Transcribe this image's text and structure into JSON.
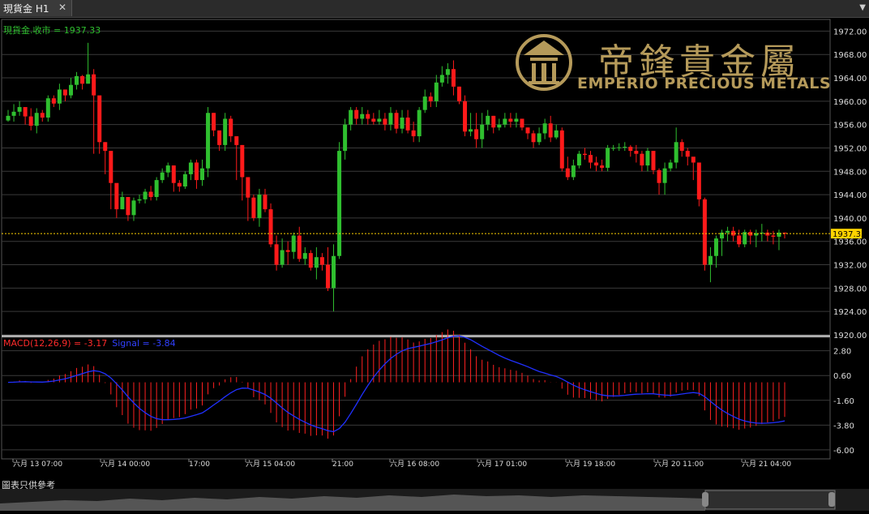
{
  "tab": {
    "title": "現貨金 H1",
    "close": "✕",
    "menu": "▼"
  },
  "price_legend": "現貨金.收市 = 1937.33",
  "macd_legend": {
    "macd": "MACD(12,26,9) = -3.17",
    "signal": "Signal = -3.84"
  },
  "footer_note": "圖表只供參考",
  "logo": {
    "en": "EMPERIO PRECIOUS METALS",
    "cn": "帝鋒貴金屬"
  },
  "colors": {
    "up": "#2fbf2f",
    "down": "#ff1a1a",
    "macd_hist": "#ff2020",
    "signal": "#2030ff",
    "current": "#ffd400",
    "grid": "#3a3a3a",
    "bg": "#000000"
  },
  "chart_data": [
    {
      "type": "candlestick",
      "title": "現貨金 H1",
      "current_price": 1937.33,
      "current_price_label": "1937.33",
      "ylim": [
        1920,
        1974
      ],
      "y_ticks": [
        "1972.00",
        "1968.00",
        "1964.00",
        "1960.00",
        "1956.00",
        "1952.00",
        "1948.00",
        "1944.00",
        "1940.00",
        "1936.00",
        "1932.00",
        "1928.00",
        "1924.00",
        "1920.00"
      ],
      "x_tick_labels": [
        "六月 13 07:00",
        "六月 14 00:00",
        "17:00",
        "六月 15 04:00",
        "21:00",
        "六月 16 08:00",
        "六月 17 01:00",
        "六月 19 18:00",
        "六月 20 11:00",
        "六月 21 04:00"
      ],
      "closes": [
        1957.5,
        1958.2,
        1959.0,
        1957.4,
        1955.8,
        1958.0,
        1957.2,
        1960.5,
        1959.6,
        1962.0,
        1961.0,
        1962.8,
        1964.3,
        1963.0,
        1964.6,
        1961.0,
        1953.0,
        1951.5,
        1946.0,
        1941.5,
        1943.6,
        1940.5,
        1943.0,
        1943.2,
        1944.5,
        1943.6,
        1946.5,
        1947.8,
        1949.0,
        1946.0,
        1945.4,
        1947.5,
        1949.5,
        1946.5,
        1948.5,
        1958.0,
        1955.0,
        1952.5,
        1957.0,
        1954.0,
        1952.5,
        1947.0,
        1943.5,
        1940.0,
        1944.0,
        1941.5,
        1935.5,
        1932.0,
        1934.5,
        1934.2,
        1937.0,
        1933.0,
        1934.0,
        1931.5,
        1933.3,
        1932.0,
        1928.0,
        1933.5,
        1951.5,
        1956.0,
        1958.5,
        1957.0,
        1957.8,
        1957.0,
        1956.5,
        1957.0,
        1956.0,
        1958.0,
        1955.3,
        1957.2,
        1955.0,
        1954.0,
        1958.5,
        1960.8,
        1960.0,
        1963.2,
        1964.5,
        1965.5,
        1962.5,
        1960.0,
        1954.8,
        1955.2,
        1953.5,
        1956.0,
        1957.5,
        1955.5,
        1956.0,
        1957.0,
        1956.5,
        1957.0,
        1955.5,
        1954.5,
        1953.0,
        1954.5,
        1956.2,
        1953.8,
        1955.0,
        1948.5,
        1947.0,
        1949.0,
        1951.0,
        1950.8,
        1949.5,
        1949.0,
        1948.6,
        1952.0,
        1952.0,
        1952.1,
        1952.2,
        1951.5,
        1951.0,
        1949.0,
        1951.5,
        1948.2,
        1946.0,
        1948.5,
        1949.5,
        1953.0,
        1951.5,
        1950.5,
        1949.5,
        1943.2,
        1932.0,
        1933.5,
        1936.5,
        1937.5,
        1937.8,
        1937.0,
        1935.5,
        1937.6,
        1937.0,
        1937.4,
        1937.5,
        1937.0,
        1936.8,
        1937.5,
        1937.33
      ],
      "highs": [
        1958.5,
        1959.5,
        1960.0,
        1958.5,
        1958.8,
        1958.8,
        1958.5,
        1961.0,
        1961.0,
        1963.0,
        1962.0,
        1964.0,
        1965.0,
        1964.5,
        1970.0,
        1965.5,
        1958.0,
        1953.0,
        1951.5,
        1944.0,
        1944.5,
        1943.5,
        1943.5,
        1944.0,
        1945.0,
        1945.5,
        1947.0,
        1948.5,
        1949.5,
        1949.0,
        1946.5,
        1948.0,
        1950.0,
        1950.0,
        1950.0,
        1959.0,
        1958.0,
        1954.0,
        1958.0,
        1957.5,
        1954.0,
        1952.5,
        1947.0,
        1944.0,
        1945.0,
        1945.0,
        1942.5,
        1937.0,
        1936.5,
        1936.0,
        1937.5,
        1938.5,
        1935.0,
        1934.5,
        1935.0,
        1934.0,
        1935.0,
        1935.5,
        1953.0,
        1957.0,
        1959.0,
        1959.0,
        1959.0,
        1958.5,
        1958.0,
        1958.5,
        1958.0,
        1959.0,
        1958.5,
        1958.5,
        1958.5,
        1956.5,
        1959.0,
        1962.0,
        1961.5,
        1964.5,
        1966.0,
        1966.5,
        1967.0,
        1962.5,
        1961.0,
        1958.0,
        1958.0,
        1958.0,
        1958.5,
        1957.5,
        1957.0,
        1958.0,
        1958.0,
        1958.0,
        1957.0,
        1955.5,
        1955.0,
        1955.5,
        1957.0,
        1957.5,
        1956.0,
        1955.5,
        1950.5,
        1950.0,
        1951.5,
        1952.0,
        1951.5,
        1950.5,
        1950.0,
        1952.5,
        1952.5,
        1952.8,
        1953.0,
        1952.5,
        1952.5,
        1951.5,
        1952.0,
        1951.5,
        1948.5,
        1949.5,
        1950.0,
        1955.5,
        1953.5,
        1952.0,
        1950.0,
        1949.0,
        1943.5,
        1935.0,
        1937.0,
        1938.0,
        1938.5,
        1938.5,
        1938.0,
        1938.0,
        1938.0,
        1938.0,
        1939.0,
        1938.0,
        1937.8,
        1938.0,
        1937.5
      ],
      "lows": [
        1956.5,
        1956.5,
        1957.5,
        1956.0,
        1955.0,
        1954.5,
        1956.5,
        1956.5,
        1959.0,
        1958.5,
        1960.0,
        1960.5,
        1962.0,
        1962.0,
        1963.0,
        1951.0,
        1951.0,
        1947.5,
        1941.5,
        1940.0,
        1941.5,
        1939.5,
        1939.5,
        1942.5,
        1942.5,
        1943.0,
        1943.0,
        1946.0,
        1947.0,
        1944.5,
        1944.5,
        1945.0,
        1946.5,
        1945.0,
        1945.5,
        1947.0,
        1954.0,
        1951.5,
        1951.5,
        1953.0,
        1946.5,
        1943.0,
        1939.5,
        1939.5,
        1938.5,
        1941.0,
        1935.0,
        1931.0,
        1931.5,
        1932.0,
        1933.0,
        1932.5,
        1932.0,
        1931.0,
        1929.5,
        1931.0,
        1927.5,
        1924.0,
        1933.0,
        1950.0,
        1955.0,
        1956.0,
        1956.0,
        1956.0,
        1956.0,
        1956.0,
        1955.0,
        1955.0,
        1954.5,
        1954.5,
        1954.5,
        1953.0,
        1953.0,
        1958.0,
        1959.0,
        1959.0,
        1962.5,
        1963.0,
        1961.0,
        1959.5,
        1954.0,
        1954.0,
        1952.0,
        1952.0,
        1955.0,
        1954.5,
        1955.0,
        1955.5,
        1955.5,
        1955.5,
        1955.0,
        1953.5,
        1952.0,
        1952.5,
        1953.5,
        1953.0,
        1953.5,
        1948.0,
        1946.5,
        1946.5,
        1948.5,
        1950.0,
        1948.5,
        1948.0,
        1948.0,
        1948.0,
        1951.5,
        1951.5,
        1951.5,
        1950.5,
        1949.5,
        1948.0,
        1948.0,
        1947.5,
        1944.0,
        1944.0,
        1948.0,
        1948.5,
        1950.5,
        1949.0,
        1946.5,
        1942.0,
        1931.0,
        1929.0,
        1931.5,
        1933.5,
        1936.0,
        1936.0,
        1935.0,
        1935.0,
        1935.5,
        1935.0,
        1936.0,
        1936.0,
        1935.5,
        1934.5,
        1936.5,
        1937.0
      ]
    },
    {
      "type": "macd",
      "title": "MACD(12,26,9)",
      "macd_value": -3.17,
      "signal_value": -3.84,
      "ylim": [
        -6.8,
        4.0
      ],
      "y_ticks": [
        "2.80",
        "0.60",
        "-1.60",
        "-3.80",
        "-6.00"
      ]
    }
  ]
}
